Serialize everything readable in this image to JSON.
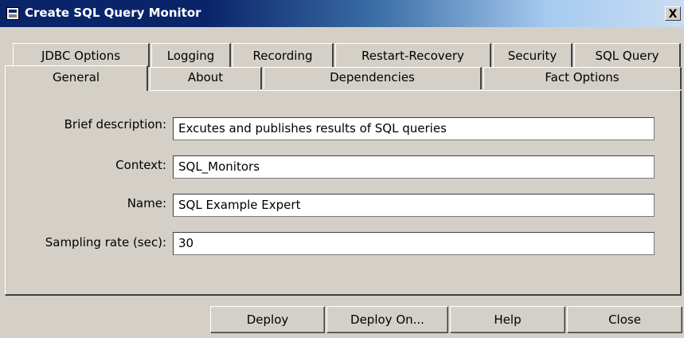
{
  "window": {
    "title": "Create SQL Query Monitor",
    "close_label": "X"
  },
  "tabs_row1": [
    {
      "label": "JDBC Options"
    },
    {
      "label": "Logging"
    },
    {
      "label": "Recording"
    },
    {
      "label": "Restart-Recovery"
    },
    {
      "label": "Security"
    },
    {
      "label": "SQL Query"
    }
  ],
  "tabs_row2": [
    {
      "label": "General",
      "active": true
    },
    {
      "label": "About"
    },
    {
      "label": "Dependencies"
    },
    {
      "label": "Fact Options"
    }
  ],
  "form": {
    "brief_description_label": "Brief description:",
    "brief_description_value": "Excutes and publishes results of SQL queries",
    "context_label": "Context:",
    "context_value": "SQL_Monitors",
    "name_label": "Name:",
    "name_value": "SQL Example Expert",
    "sampling_rate_label": "Sampling rate (sec):",
    "sampling_rate_value": "30"
  },
  "buttons": {
    "deploy": "Deploy",
    "deploy_on": "Deploy On...",
    "help": "Help",
    "close": "Close"
  }
}
